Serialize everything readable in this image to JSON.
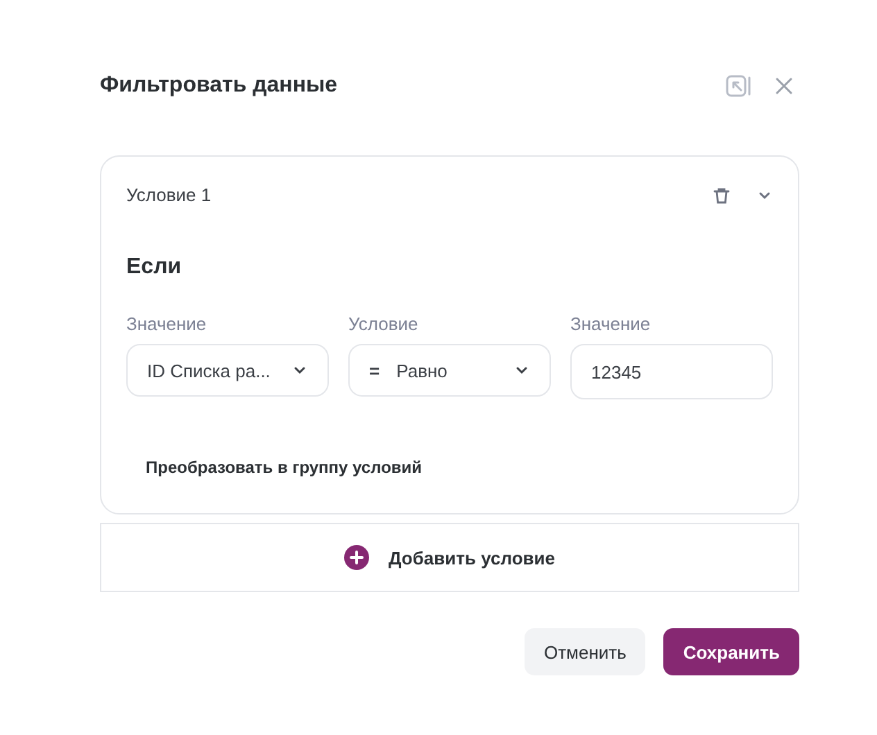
{
  "dialog": {
    "title": "Фильтровать данные"
  },
  "condition": {
    "title": "Условие 1",
    "expanded": true,
    "heading": "Если",
    "fields": [
      {
        "kind": "select",
        "label": "Значение",
        "value": "ID Списка ра..."
      },
      {
        "kind": "select",
        "label": "Условие",
        "symbol": "=",
        "value": "Равно"
      },
      {
        "kind": "input",
        "label": "Значение",
        "value": "12345"
      }
    ],
    "convert_link": "Преобразовать в группу условий"
  },
  "add_condition": "Добавить условие",
  "buttons": [
    {
      "kind": "secondary",
      "label": "Отменить"
    },
    {
      "kind": "primary",
      "label": "Сохранить"
    }
  ]
}
